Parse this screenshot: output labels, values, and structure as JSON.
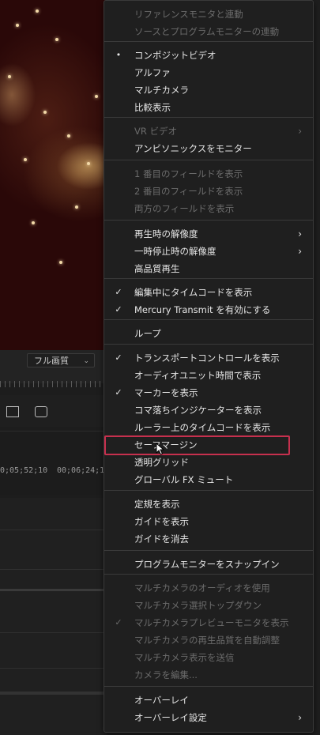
{
  "background": {
    "quality_dropdown": "フル画質",
    "timecodes": [
      "0;05;52;10",
      "00;06;24;12"
    ]
  },
  "menu": {
    "items": [
      {
        "label": "リファレンスモニタと連動",
        "enabled": false,
        "mark": "",
        "submenu": false
      },
      {
        "label": "ソースとプログラムモニターの連動",
        "enabled": false,
        "mark": "",
        "submenu": false
      },
      {
        "label": "コンポジットビデオ",
        "enabled": true,
        "mark": "•",
        "submenu": false
      },
      {
        "label": "アルファ",
        "enabled": true,
        "mark": "",
        "submenu": false
      },
      {
        "label": "マルチカメラ",
        "enabled": true,
        "mark": "",
        "submenu": false
      },
      {
        "label": "比較表示",
        "enabled": true,
        "mark": "",
        "submenu": false
      },
      {
        "label": "VR ビデオ",
        "enabled": false,
        "mark": "",
        "submenu": true
      },
      {
        "label": "アンビソニックスをモニター",
        "enabled": true,
        "mark": "",
        "submenu": false
      },
      {
        "label": "1 番目のフィールドを表示",
        "enabled": false,
        "mark": "",
        "submenu": false
      },
      {
        "label": "2 番目のフィールドを表示",
        "enabled": false,
        "mark": "",
        "submenu": false
      },
      {
        "label": "両方のフィールドを表示",
        "enabled": false,
        "mark": "",
        "submenu": false
      },
      {
        "label": "再生時の解像度",
        "enabled": true,
        "mark": "",
        "submenu": true
      },
      {
        "label": "一時停止時の解像度",
        "enabled": true,
        "mark": "",
        "submenu": true
      },
      {
        "label": "高品質再生",
        "enabled": true,
        "mark": "",
        "submenu": false
      },
      {
        "label": "編集中にタイムコードを表示",
        "enabled": true,
        "mark": "✓",
        "submenu": false
      },
      {
        "label": "Mercury Transmit を有効にする",
        "enabled": true,
        "mark": "✓",
        "submenu": false
      },
      {
        "label": "ループ",
        "enabled": true,
        "mark": "",
        "submenu": false
      },
      {
        "label": "トランスポートコントロールを表示",
        "enabled": true,
        "mark": "✓",
        "submenu": false
      },
      {
        "label": "オーディオユニット時間で表示",
        "enabled": true,
        "mark": "",
        "submenu": false
      },
      {
        "label": "マーカーを表示",
        "enabled": true,
        "mark": "✓",
        "submenu": false
      },
      {
        "label": "コマ落ちインジケーターを表示",
        "enabled": true,
        "mark": "",
        "submenu": false
      },
      {
        "label": "ルーラー上のタイムコードを表示",
        "enabled": true,
        "mark": "",
        "submenu": false
      },
      {
        "label": "セーフマージン",
        "enabled": true,
        "mark": "",
        "submenu": false
      },
      {
        "label": "透明グリッド",
        "enabled": true,
        "mark": "",
        "submenu": false
      },
      {
        "label": "グローバル FX ミュート",
        "enabled": true,
        "mark": "",
        "submenu": false
      },
      {
        "label": "定規を表示",
        "enabled": true,
        "mark": "",
        "submenu": false
      },
      {
        "label": "ガイドを表示",
        "enabled": true,
        "mark": "",
        "submenu": false
      },
      {
        "label": "ガイドを消去",
        "enabled": true,
        "mark": "",
        "submenu": false
      },
      {
        "label": "プログラムモニターをスナップイン",
        "enabled": true,
        "mark": "",
        "submenu": false
      },
      {
        "label": "マルチカメラのオーディオを使用",
        "enabled": false,
        "mark": "",
        "submenu": false
      },
      {
        "label": "マルチカメラ選択トップダウン",
        "enabled": false,
        "mark": "",
        "submenu": false
      },
      {
        "label": "マルチカメラプレビューモニタを表示",
        "enabled": false,
        "mark": "✓",
        "submenu": false
      },
      {
        "label": "マルチカメラの再生品質を自動調整",
        "enabled": false,
        "mark": "",
        "submenu": false
      },
      {
        "label": "マルチカメラ表示を送信",
        "enabled": false,
        "mark": "",
        "submenu": false
      },
      {
        "label": "カメラを編集...",
        "enabled": false,
        "mark": "",
        "submenu": false
      },
      {
        "label": "オーバーレイ",
        "enabled": true,
        "mark": "",
        "submenu": false
      },
      {
        "label": "オーバーレイ設定",
        "enabled": true,
        "mark": "",
        "submenu": true
      }
    ]
  }
}
